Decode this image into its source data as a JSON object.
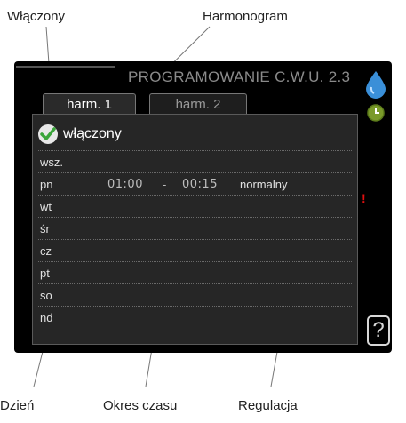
{
  "callouts": {
    "enabled": "Włączony",
    "schedule": "Harmonogram",
    "day": "Dzień",
    "time_period": "Okres czasu",
    "adjustment": "Regulacja"
  },
  "screen": {
    "title": "PROGRAMOWANIE C.W.U.  2.3",
    "tabs": [
      {
        "label": "harm. 1",
        "active": true
      },
      {
        "label": "harm. 2",
        "active": false
      }
    ],
    "enabled_label": "włączony",
    "rows": [
      {
        "day": "wsz.",
        "start": "",
        "dash": "",
        "end": "",
        "mode": ""
      },
      {
        "day": "pn",
        "start": "01:00",
        "dash": "-",
        "end": "00:15",
        "mode": "normalny"
      },
      {
        "day": "wt",
        "start": "",
        "dash": "",
        "end": "",
        "mode": ""
      },
      {
        "day": "śr",
        "start": "",
        "dash": "",
        "end": "",
        "mode": ""
      },
      {
        "day": "cz",
        "start": "",
        "dash": "",
        "end": "",
        "mode": ""
      },
      {
        "day": "pt",
        "start": "",
        "dash": "",
        "end": "",
        "mode": ""
      },
      {
        "day": "so",
        "start": "",
        "dash": "",
        "end": "",
        "mode": ""
      },
      {
        "day": "nd",
        "start": "",
        "dash": "",
        "end": "",
        "mode": ""
      }
    ],
    "warning_mark": "!",
    "help_label": "?",
    "icons": [
      "water-drop-icon",
      "clock-icon",
      "help-icon",
      "check-icon"
    ],
    "colors": {
      "accent_blue": "#3a8fd8",
      "check_green": "#3aa53a",
      "warning_red": "#e01010",
      "screen_bg": "#000000"
    }
  }
}
